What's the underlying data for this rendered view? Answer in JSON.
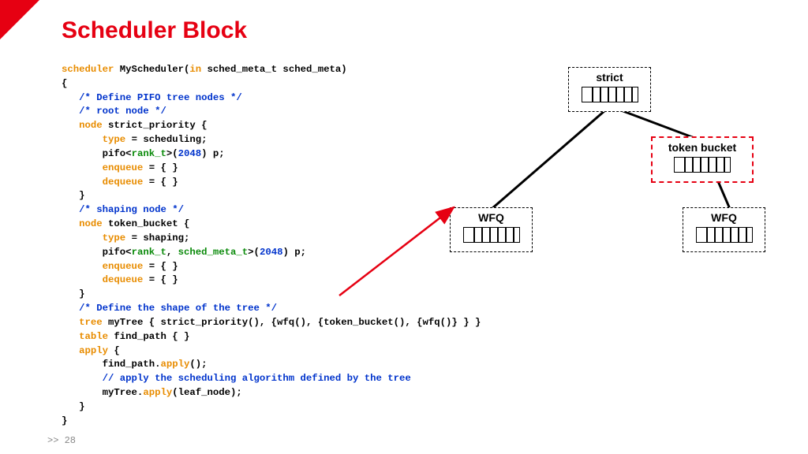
{
  "title": "Scheduler Block",
  "footer": ">> 28",
  "code": {
    "l01a": "scheduler",
    "l01b": " MyScheduler(",
    "l01c": "in",
    "l01d": " sched_meta_t sched_meta)",
    "l02": "{",
    "l03": "   /* Define PIFO tree nodes */",
    "l04": "   /* root node */",
    "l05a": "   ",
    "l05b": "node",
    "l05c": " strict_priority {",
    "l06a": "       ",
    "l06b": "type",
    "l06c": " = scheduling;",
    "l07a": "       pifo<",
    "l07b": "rank_t",
    "l07c": ">(",
    "l07d": "2048",
    "l07e": ") p;",
    "l08a": "       ",
    "l08b": "enqueue",
    "l08c": " = { }",
    "l09a": "       ",
    "l09b": "dequeue",
    "l09c": " = { }",
    "l10": "   }",
    "l11": "   /* shaping node */",
    "l12a": "   ",
    "l12b": "node",
    "l12c": " token_bucket {",
    "l13a": "       ",
    "l13b": "type",
    "l13c": " = shaping;",
    "l14a": "       pifo<",
    "l14b": "rank_t",
    "l14c": ", ",
    "l14d": "sched_meta_t",
    "l14e": ">(",
    "l14f": "2048",
    "l14g": ") p;",
    "l15a": "       ",
    "l15b": "enqueue",
    "l15c": " = { }",
    "l16a": "       ",
    "l16b": "dequeue",
    "l16c": " = { }",
    "l17": "   }",
    "l18": "   /* Define the shape of the tree */",
    "l19a": "   ",
    "l19b": "tree",
    "l19c": " myTree { strict_priority(), {wfq(), {token_bucket(), {wfq()} } }",
    "l20a": "   ",
    "l20b": "table",
    "l20c": " find_path { }",
    "l21a": "   ",
    "l21b": "apply",
    "l21c": " {",
    "l22a": "       find_path.",
    "l22b": "apply",
    "l22c": "();",
    "l23": "       // apply the scheduling algorithm defined by the tree",
    "l24a": "       myTree.",
    "l24b": "apply",
    "l24c": "(leaf_node);",
    "l25": "   }",
    "l26": "}"
  },
  "diagram": {
    "strict": "strict",
    "token_bucket": "token bucket",
    "wfq1": "WFQ",
    "wfq2": "WFQ"
  }
}
